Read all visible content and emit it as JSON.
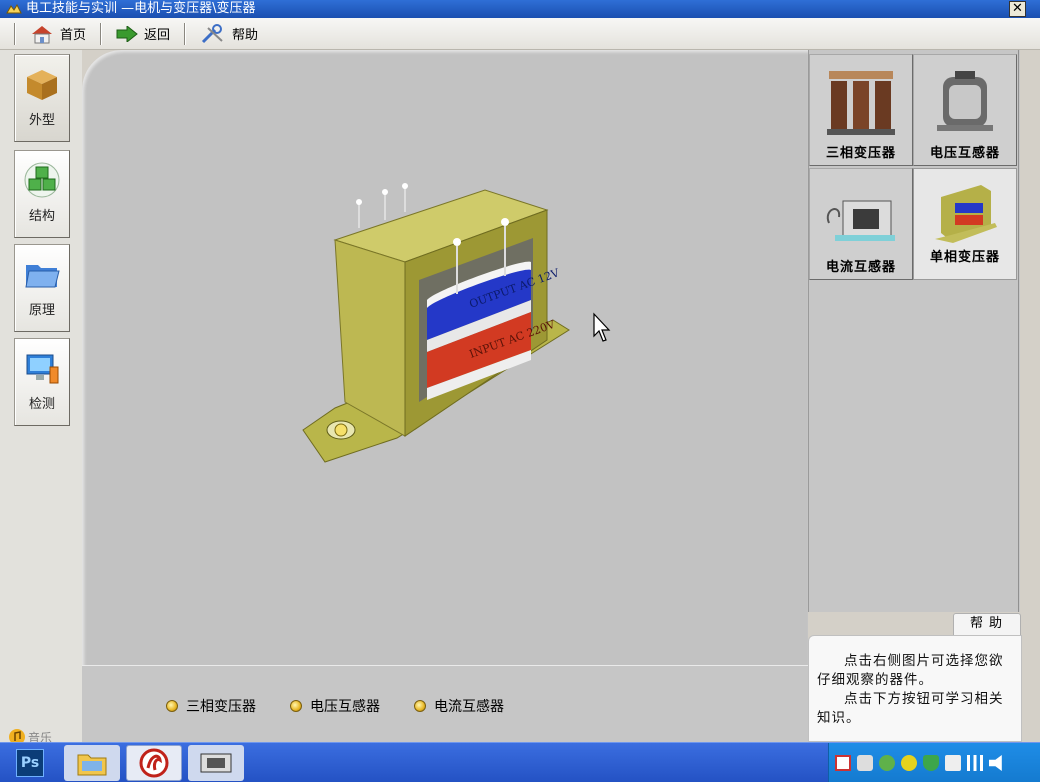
{
  "window": {
    "title": "电工技能与实训 —电机与变压器\\变压器",
    "close_label": "✕"
  },
  "toolbar": {
    "home_label": "首页",
    "back_label": "返回",
    "help_label": "帮助"
  },
  "sidebar": {
    "items": [
      {
        "label": "外型",
        "icon": "package-icon",
        "active": true
      },
      {
        "label": "结构",
        "icon": "cubes-icon",
        "active": false
      },
      {
        "label": "原理",
        "icon": "folder-icon",
        "active": false
      },
      {
        "label": "检测",
        "icon": "monitor-icon",
        "active": false
      }
    ]
  },
  "stage": {
    "transformer": {
      "upper_coil": "OUTPUT AC 12V",
      "lower_coil": "INPUT AC 220V"
    },
    "bottom_links": [
      "三相变压器",
      "电压互感器",
      "电流互感器"
    ]
  },
  "right_panel": {
    "tiles": [
      {
        "label": "三相变压器",
        "icon": "three-phase-transformer-icon"
      },
      {
        "label": "电压互感器",
        "icon": "voltage-transformer-icon"
      },
      {
        "label": "电流互感器",
        "icon": "current-transformer-icon"
      },
      {
        "label": "单相变压器",
        "icon": "single-phase-transformer-icon",
        "selected": true
      }
    ]
  },
  "help": {
    "tab_label": "帮助",
    "lines": [
      "点击右侧图片可选择您欲仔细观察的器件。",
      "点击下方按钮可学习相关知识。"
    ]
  },
  "music_label": "音乐",
  "taskbar": {
    "ps_label": "Ps"
  },
  "colors": {
    "titlebar": "#1a4fb0",
    "stage": "#c2c2c2",
    "taskbar": "#2452c4",
    "tray": "#147acf"
  }
}
